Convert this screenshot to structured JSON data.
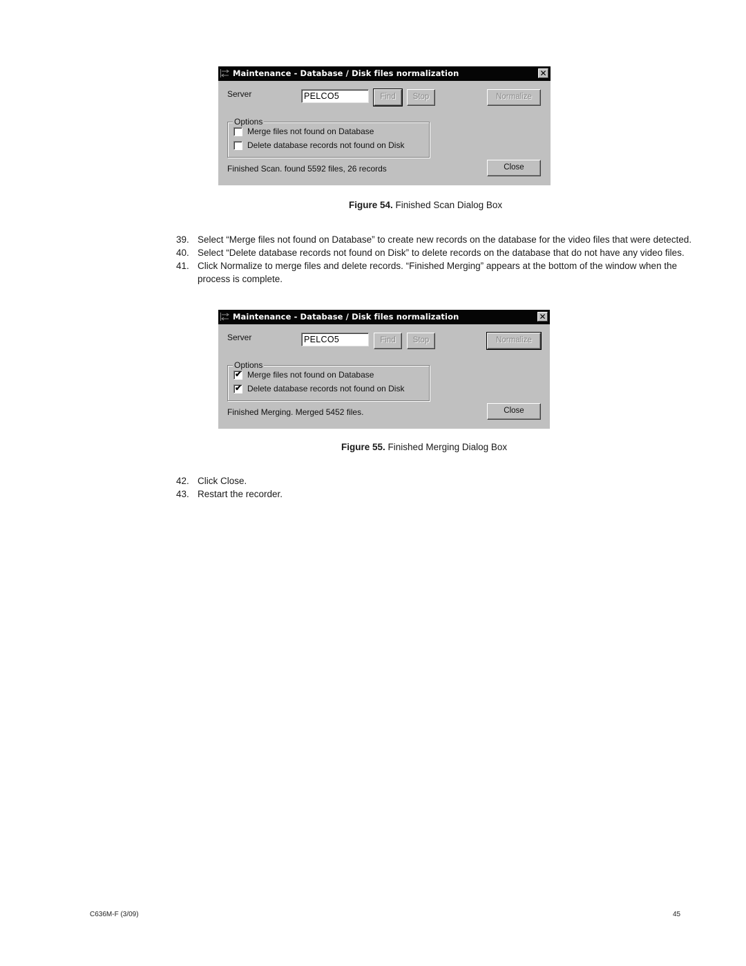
{
  "dialogs": [
    {
      "title": "Maintenance - Database / Disk files normalization",
      "server_label": "Server",
      "server_value": "PELCO5",
      "buttons": {
        "find": "Find",
        "stop": "Stop",
        "normalize": "Normalize",
        "close": "Close"
      },
      "options_label": "Options",
      "options": [
        {
          "label": "Merge files not found on Database",
          "checked": false
        },
        {
          "label": "Delete database records not found on Disk",
          "checked": false
        }
      ],
      "status": "Finished Scan. found 5592 files, 26 records"
    },
    {
      "title": "Maintenance - Database / Disk files normalization",
      "server_label": "Server",
      "server_value": "PELCO5",
      "buttons": {
        "find": "Find",
        "stop": "Stop",
        "normalize": "Normalize",
        "close": "Close"
      },
      "options_label": "Options",
      "options": [
        {
          "label": "Merge files not found on Database",
          "checked": true
        },
        {
          "label": "Delete database records not found on Disk",
          "checked": true
        }
      ],
      "status": "Finished Merging. Merged 5452 files."
    }
  ],
  "figures": [
    {
      "number": "Figure 54.",
      "caption": "Finished Scan Dialog Box"
    },
    {
      "number": "Figure 55.",
      "caption": "Finished Merging Dialog Box"
    }
  ],
  "steps": [
    {
      "num": "39.",
      "text": "Select “Merge files not found on Database” to create new records on the database for the video files that were detected."
    },
    {
      "num": "40.",
      "text": "Select “Delete database records not found on Disk” to delete records on the database that do not have any video files."
    },
    {
      "num": "41.",
      "text": "Click Normalize to merge files and delete records. “Finished Merging” appears at the bottom of the window when the",
      "text_cont": "process is complete."
    },
    {
      "num": "42.",
      "text": "Click Close."
    },
    {
      "num": "43.",
      "text": "Restart the recorder."
    }
  ],
  "footer": {
    "doc_id": "C636M-F (3/09)",
    "page": "45"
  },
  "check_glyph": "✔",
  "close_glyph": "✕"
}
